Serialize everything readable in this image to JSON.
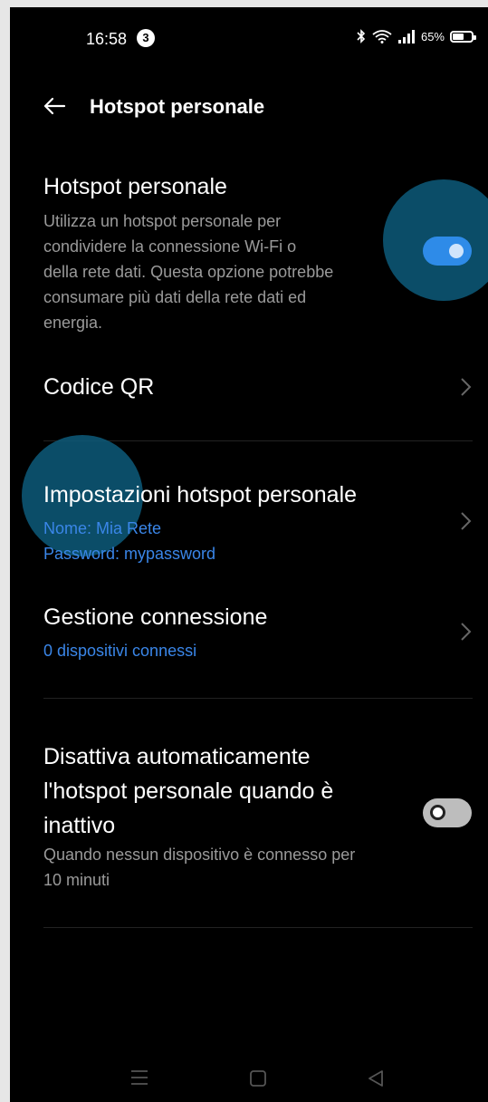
{
  "status_bar": {
    "time": "16:58",
    "notification_count": "3",
    "battery": "65%",
    "battery_level": 0.65
  },
  "header": {
    "title": "Hotspot personale"
  },
  "hotspot": {
    "title": "Hotspot personale",
    "description_lines": [
      "Utilizza un hotspot personale per",
      "condividere la connessione Wi-Fi o",
      "della rete dati. Questa opzione potrebbe",
      "consumare più dati della rete dati ed",
      "energia."
    ],
    "enabled": true
  },
  "qr": {
    "title": "Codice QR"
  },
  "settings": {
    "title": "Impostazioni hotspot personale",
    "name": "Nome: Mia Rete",
    "password": "Password: mypassword"
  },
  "connections": {
    "title": "Gestione connessione",
    "subtitle": "0 dispositivi connessi"
  },
  "auto_off": {
    "title_lines": [
      "Disattiva automaticamente",
      "l'hotspot personale quando è",
      "inattivo"
    ],
    "description_lines": [
      "Quando nessun dispositivo è connesso per",
      "10 minuti"
    ],
    "enabled": false
  },
  "colors": {
    "accent": "#2e8be8",
    "link_text": "#3a86e8",
    "highlight": "#0d5a7a"
  }
}
